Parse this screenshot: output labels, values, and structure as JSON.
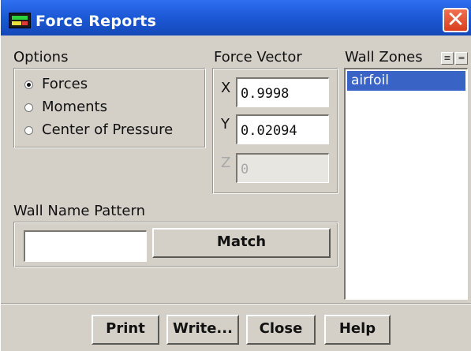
{
  "window": {
    "title": "Force Reports",
    "close_glyph": "✕"
  },
  "options": {
    "heading": "Options",
    "radios": [
      {
        "label": "Forces",
        "selected": true
      },
      {
        "label": "Moments",
        "selected": false
      },
      {
        "label": "Center of Pressure",
        "selected": false
      }
    ]
  },
  "force_vector": {
    "heading": "Force Vector",
    "x_label": "X",
    "x_value": "0.9998",
    "y_label": "Y",
    "y_value": "0.02094",
    "z_label": "Z",
    "z_value": "0"
  },
  "wall_zones": {
    "heading": "Wall Zones",
    "select_all_glyph": "≡",
    "deselect_all_glyph": "=",
    "items": [
      {
        "label": "airfoil",
        "selected": true
      }
    ]
  },
  "wall_name_pattern": {
    "heading": "Wall Name Pattern",
    "value": "",
    "match_label": "Match"
  },
  "buttons": {
    "print": "Print",
    "write": "Write...",
    "close": "Close",
    "help": "Help"
  },
  "colors": {
    "titlebar": "#1d5ad8",
    "selection": "#3a63c6",
    "dialog_bg": "#d4d0c8",
    "close_button": "#d8401e"
  },
  "icons": {
    "app": "fluent-app-icon",
    "close": "close-icon"
  }
}
